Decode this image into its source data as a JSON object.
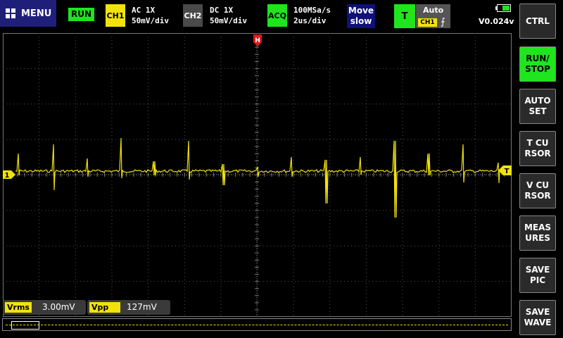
{
  "topbar": {
    "menu_label": "MENU",
    "run_status": "RUN",
    "ch1": {
      "tag": "CH1",
      "coupling": "AC  1X",
      "scale": "50mV/div",
      "color": "#f2e20c"
    },
    "ch2": {
      "tag": "CH2",
      "coupling": "DC  1X",
      "scale": "50mV/div",
      "color": "#4a4a4a"
    },
    "acq": {
      "tag": "ACQ",
      "rate": "100MSa/s",
      "timebase": "2us/div",
      "color": "#1ee51e"
    },
    "move": {
      "line1": "Move",
      "line2": "slow"
    },
    "trigger": {
      "tag": "T",
      "mode": "Auto",
      "source": "CH1",
      "edge": "⨍",
      "level": "V0.024v"
    },
    "battery_level": 0.6
  },
  "scope": {
    "h_marker": "H",
    "ch1_marker": "1",
    "trig_marker": "T",
    "trace_color": "#f2e20c",
    "grid_color": "#555555"
  },
  "measurements": [
    {
      "label": "Vrms",
      "value": "3.00mV"
    },
    {
      "label": "Vpp",
      "value": "127mV"
    }
  ],
  "side_buttons": [
    {
      "label": "CTRL"
    },
    {
      "label": "RUN/\nSTOP"
    },
    {
      "label": "AUTO\nSET"
    },
    {
      "label": "T CU\nRSOR"
    },
    {
      "label": "V CU\nRSOR"
    },
    {
      "label": "MEAS\nURES"
    },
    {
      "label": "SAVE\nPIC"
    },
    {
      "label": "SAVE\nWAVE"
    }
  ]
}
